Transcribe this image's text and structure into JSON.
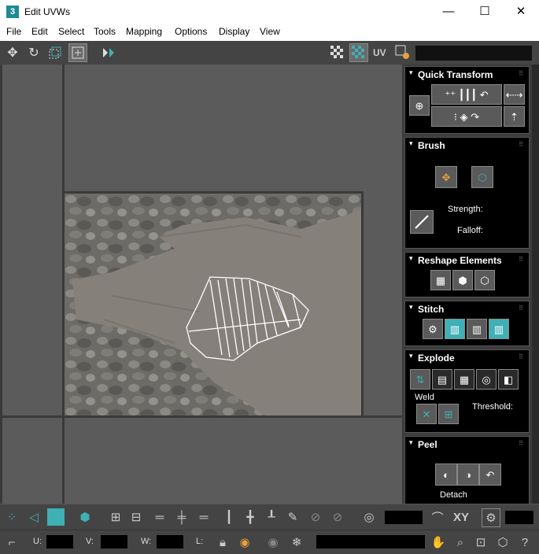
{
  "window": {
    "app_icon": "3",
    "title": "Edit UVWs",
    "minimize": "—",
    "maximize": "☐",
    "close": "✕"
  },
  "menu": {
    "items": [
      "File",
      "Edit",
      "Select",
      "Tools",
      "Mapping",
      "Options",
      "Display",
      "View"
    ]
  },
  "toolbar": {
    "uv_label": "UV"
  },
  "panel": {
    "quick_transform": {
      "title": "Quick Transform"
    },
    "brush": {
      "title": "Brush",
      "strength_label": "Strength:",
      "falloff_label": "Falloff:"
    },
    "reshape": {
      "title": "Reshape Elements"
    },
    "stitch": {
      "title": "Stitch"
    },
    "explode": {
      "title": "Explode",
      "weld_label": "Weld",
      "threshold_label": "Threshold:"
    },
    "peel": {
      "title": "Peel",
      "detach_label": "Detach"
    }
  },
  "bottom": {
    "xy_label": "XY",
    "u_label": "U:",
    "v_label": "V:",
    "w_label": "W:",
    "l_label": "L:"
  },
  "colors": {
    "accent": "#3fb0b5",
    "panel_bg": "#000000",
    "viewport_bg": "#5b5b5b"
  },
  "icons": [
    "move-icon",
    "rotate-icon",
    "scale-icon",
    "freeform-icon",
    "mirror-icon",
    "checker-icon",
    "uv-icon",
    "settings-icon",
    "brush-icon",
    "snap-icon",
    "pan-icon",
    "zoom-icon",
    "lock-icon",
    "freeze-icon"
  ]
}
